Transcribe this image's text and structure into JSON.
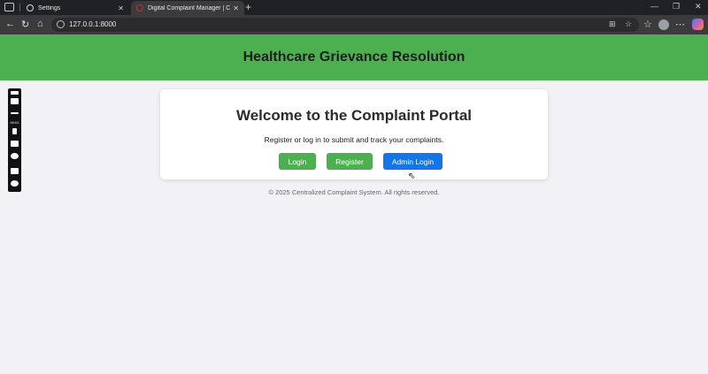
{
  "browser": {
    "tabs": [
      {
        "title": "Settings",
        "icon": "gear-icon"
      },
      {
        "title": "Digital Complaint Manager | Com",
        "icon": "favicon"
      }
    ],
    "url": "127.0.0.1:8000"
  },
  "recorder": {
    "time": "00:01"
  },
  "page": {
    "header_title": "Healthcare Grievance Resolution",
    "welcome_title": "Welcome to the Complaint Portal",
    "welcome_text": "Register or log in to submit and track your complaints.",
    "buttons": {
      "login": "Login",
      "register": "Register",
      "admin_login": "Admin Login"
    },
    "footer": "© 2025 Centralized Complaint System. All rights reserved."
  },
  "colors": {
    "header_bg": "#4caf50",
    "primary_green": "#4caf50",
    "admin_blue": "#1475e8",
    "page_bg": "#f1f1f6"
  }
}
